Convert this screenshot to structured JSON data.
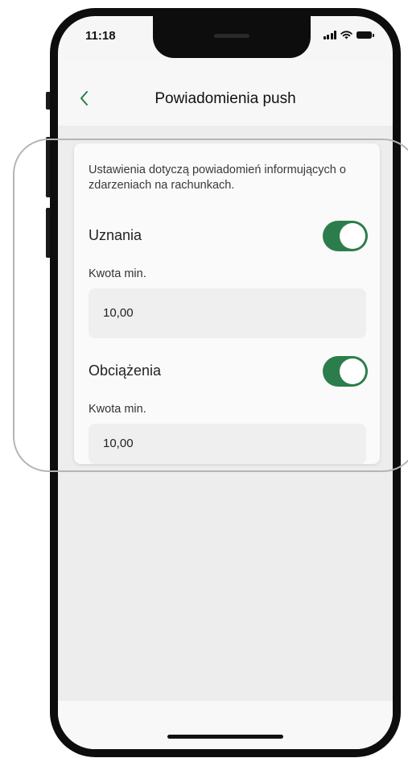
{
  "status_bar": {
    "time": "11:18"
  },
  "header": {
    "back_icon": "chevron-left-icon",
    "title": "Powiadomienia push"
  },
  "settings": {
    "description": "Ustawienia dotyczą powiadomień informujących o zdarzeniach na rachunkach.",
    "credits": {
      "label": "Uznania",
      "enabled": true,
      "min_label": "Kwota min.",
      "min_value": "10,00"
    },
    "debits": {
      "label": "Obciążenia",
      "enabled": true,
      "min_label": "Kwota min.",
      "min_value": "10,00"
    }
  },
  "colors": {
    "accent": "#2c7d4c",
    "card": "#fafafa",
    "field": "#efefef"
  }
}
